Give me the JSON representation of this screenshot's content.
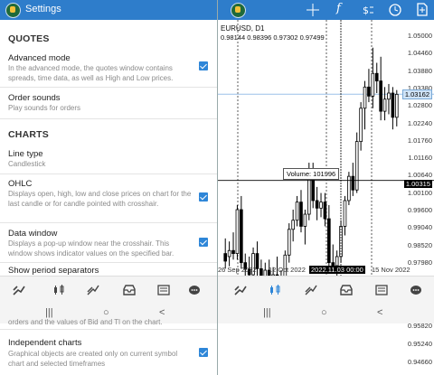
{
  "settings": {
    "title": "Settings",
    "sections": {
      "quotes": "QUOTES",
      "charts": "CHARTS"
    },
    "items": {
      "advanced_mode": {
        "title": "Advanced mode",
        "desc": "In the advanced mode, the quotes window contains spreads, time data, as well as High and Low prices.",
        "checked": true
      },
      "order_sounds": {
        "title": "Order sounds",
        "desc": "Play sounds for orders"
      },
      "line_type": {
        "title": "Line type",
        "value": "Candlestick"
      },
      "ohlc": {
        "title": "OHLC",
        "desc": "Displays open, high, low and close prices on chart for the last candle or for candle pointed with crosshair.",
        "checked": true
      },
      "data_window": {
        "title": "Data window",
        "desc": "Displays a pop-up window near the crosshair. This window shows indicator values on the specified bar.",
        "checked": true
      },
      "show_period_separators": {
        "title": "Show period separators"
      },
      "partial_behind": {
        "desc": "orders and the values of Bid and Tl on the chart."
      },
      "independent_charts": {
        "title": "Independent charts",
        "desc": "Graphical objects are created only on current symbol chart and selected timeframes",
        "checked": true
      }
    }
  },
  "chart": {
    "symbol_label": "EURUSD, D1",
    "ohlc_line": "0.98144 0.98396 0.97302 0.97499",
    "data_popup": "Volume: 101996",
    "current_price": "1.03162",
    "crosshair_price": "1.00315",
    "crosshair_date": "2022.11.03 00:00",
    "price_ticks": [
      "1.05000",
      "1.04460",
      "1.03880",
      "1.03380",
      "1.02800",
      "1.02240",
      "1.01760",
      "1.01160",
      "1.00640",
      "1.00100",
      "0.99600",
      "0.99040",
      "0.98520",
      "0.97980"
    ],
    "lower_price_ticks": [
      "0.95820",
      "0.95240",
      "0.94660"
    ],
    "date_ticks": [
      "26 Sep 2022",
      "12 Oct 2022",
      "15 Nov 2022"
    ],
    "toolbar_icons": [
      "crosshair-icon",
      "function-icon",
      "symbol-icon",
      "clock-icon",
      "new-order-icon"
    ]
  },
  "nav": {
    "icons": [
      "quotes-icon",
      "chart-icon",
      "trade-icon",
      "history-icon",
      "news-icon",
      "chat-icon"
    ],
    "system": [
      "|||",
      "○",
      "<"
    ]
  },
  "colors": {
    "brand": "#2e7dcb",
    "checkbox": "#2e86d8",
    "bear": "#000000",
    "bull": "#ffffff"
  },
  "chart_data": {
    "type": "candlestick",
    "series": [
      {
        "o": 0.979,
        "h": 0.984,
        "l": 0.974,
        "c": 0.9765
      },
      {
        "o": 0.978,
        "h": 0.983,
        "l": 0.9748,
        "c": 0.98
      },
      {
        "o": 0.98,
        "h": 0.986,
        "l": 0.977,
        "c": 0.979
      },
      {
        "o": 0.979,
        "h": 0.995,
        "l": 0.977,
        "c": 0.9935
      },
      {
        "o": 0.9935,
        "h": 0.998,
        "l": 0.974,
        "c": 0.976
      },
      {
        "o": 0.976,
        "h": 0.979,
        "l": 0.9705,
        "c": 0.9738
      },
      {
        "o": 0.9738,
        "h": 0.978,
        "l": 0.969,
        "c": 0.972
      },
      {
        "o": 0.972,
        "h": 0.981,
        "l": 0.97,
        "c": 0.979
      },
      {
        "o": 0.979,
        "h": 0.983,
        "l": 0.971,
        "c": 0.974
      },
      {
        "o": 0.974,
        "h": 0.977,
        "l": 0.966,
        "c": 0.97
      },
      {
        "o": 0.97,
        "h": 0.976,
        "l": 0.9645,
        "c": 0.9735
      },
      {
        "o": 0.9735,
        "h": 0.977,
        "l": 0.968,
        "c": 0.97
      },
      {
        "o": 0.97,
        "h": 0.9745,
        "l": 0.9665,
        "c": 0.972
      },
      {
        "o": 0.972,
        "h": 0.978,
        "l": 0.969,
        "c": 0.9705
      },
      {
        "o": 0.9705,
        "h": 0.9735,
        "l": 0.966,
        "c": 0.969
      },
      {
        "o": 0.969,
        "h": 0.98,
        "l": 0.967,
        "c": 0.9785
      },
      {
        "o": 0.9785,
        "h": 0.989,
        "l": 0.976,
        "c": 0.987
      },
      {
        "o": 0.987,
        "h": 0.9935,
        "l": 0.983,
        "c": 0.99
      },
      {
        "o": 0.99,
        "h": 0.998,
        "l": 0.988,
        "c": 0.996
      },
      {
        "o": 0.996,
        "h": 1.0,
        "l": 0.986,
        "c": 0.988
      },
      {
        "o": 0.988,
        "h": 0.9935,
        "l": 0.982,
        "c": 0.992
      },
      {
        "o": 0.992,
        "h": 1.009,
        "l": 0.99,
        "c": 1.004
      },
      {
        "o": 1.004,
        "h": 1.009,
        "l": 0.994,
        "c": 0.9965
      },
      {
        "o": 0.9965,
        "h": 1.001,
        "l": 0.99,
        "c": 0.994
      },
      {
        "o": 0.994,
        "h": 0.999,
        "l": 0.991,
        "c": 0.996
      },
      {
        "o": 0.996,
        "h": 0.999,
        "l": 0.988,
        "c": 0.9905
      },
      {
        "o": 0.9905,
        "h": 0.995,
        "l": 0.974,
        "c": 0.976
      },
      {
        "o": 0.976,
        "h": 0.982,
        "l": 0.973,
        "c": 0.975
      },
      {
        "o": 0.975,
        "h": 0.98,
        "l": 0.97,
        "c": 0.978
      },
      {
        "o": 0.978,
        "h": 0.99,
        "l": 0.976,
        "c": 0.988
      },
      {
        "o": 0.988,
        "h": 0.998,
        "l": 0.985,
        "c": 0.9965
      },
      {
        "o": 0.9965,
        "h": 1.006,
        "l": 0.995,
        "c": 1.0045
      },
      {
        "o": 1.0045,
        "h": 1.009,
        "l": 0.998,
        "c": 1.0
      },
      {
        "o": 1.0,
        "h": 1.019,
        "l": 0.999,
        "c": 1.016
      },
      {
        "o": 1.016,
        "h": 1.029,
        "l": 1.013,
        "c": 1.027
      },
      {
        "o": 1.027,
        "h": 1.036,
        "l": 1.02,
        "c": 1.034
      },
      {
        "o": 1.034,
        "h": 1.04,
        "l": 1.029,
        "c": 1.031
      },
      {
        "o": 1.031,
        "h": 1.047,
        "l": 1.027,
        "c": 1.0385
      },
      {
        "o": 1.0385,
        "h": 1.042,
        "l": 1.032,
        "c": 1.036
      },
      {
        "o": 1.036,
        "h": 1.044,
        "l": 1.023,
        "c": 1.026
      },
      {
        "o": 1.026,
        "h": 1.034,
        "l": 1.023,
        "c": 1.03
      },
      {
        "o": 1.03,
        "h": 1.035,
        "l": 1.025,
        "c": 1.032
      },
      {
        "o": 1.032,
        "h": 1.034,
        "l": 1.02,
        "c": 1.024
      },
      {
        "o": 1.024,
        "h": 1.033,
        "l": 1.021,
        "c": 1.0316
      }
    ],
    "ylim": [
      0.975,
      1.052
    ],
    "crosshair_price": 1.00315,
    "current_price": 1.03162
  }
}
